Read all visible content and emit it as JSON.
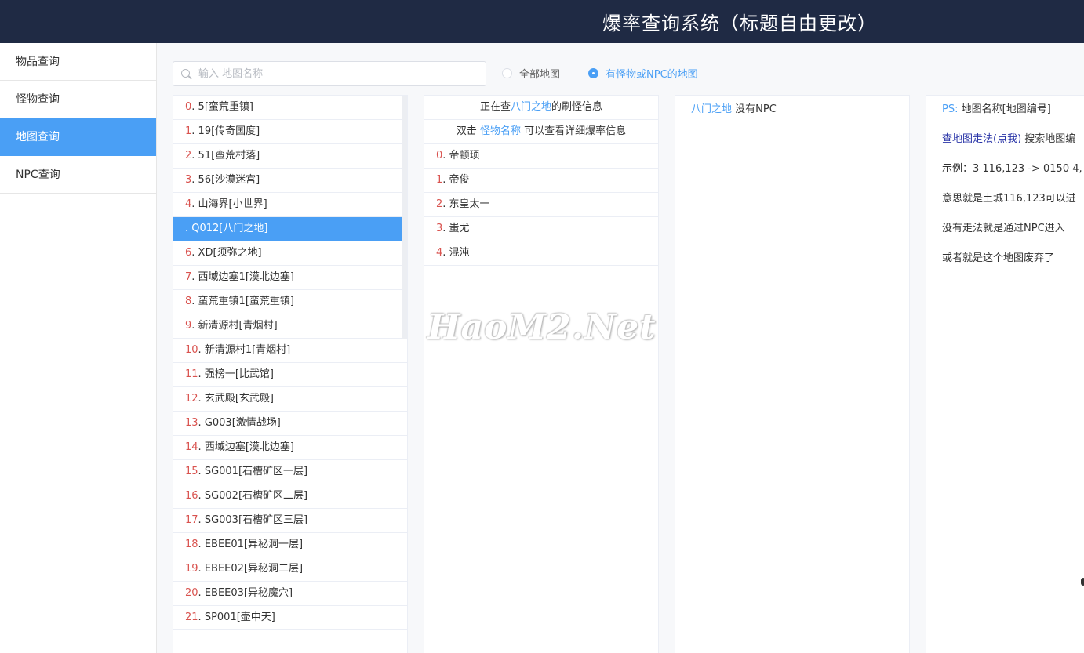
{
  "header": {
    "title": "爆率查询系统（标题自由更改）"
  },
  "sidebar": {
    "items": [
      {
        "label": "物品查询"
      },
      {
        "label": "怪物查询"
      },
      {
        "label": "地图查询"
      },
      {
        "label": "NPC查询"
      }
    ],
    "active_index": 2
  },
  "search": {
    "placeholder": "输入 地图名称"
  },
  "filters": {
    "all_maps": "全部地图",
    "with_monster_npc": "有怪物或NPC的地图",
    "selected": "with_monster_npc"
  },
  "map_list": [
    {
      "idx": "0",
      "text": "5[蛮荒重镇]"
    },
    {
      "idx": "1",
      "text": "19[传奇国度]"
    },
    {
      "idx": "2",
      "text": "51[蛮荒村落]"
    },
    {
      "idx": "3",
      "text": "56[沙漠迷宫]"
    },
    {
      "idx": "4",
      "text": "山海界[小世界]"
    },
    {
      "idx": "",
      "text": "Q012[八门之地]"
    },
    {
      "idx": "6",
      "text": "XD[须弥之地]"
    },
    {
      "idx": "7",
      "text": "西域边塞1[漠北边塞]"
    },
    {
      "idx": "8",
      "text": "蛮荒重镇1[蛮荒重镇]"
    },
    {
      "idx": "9",
      "text": "新清源村[青烟村]"
    },
    {
      "idx": "10",
      "text": "新清源村1[青烟村]"
    },
    {
      "idx": "11",
      "text": "强榜一[比武馆]"
    },
    {
      "idx": "12",
      "text": "玄武殿[玄武殿]"
    },
    {
      "idx": "13",
      "text": "G003[激情战场]"
    },
    {
      "idx": "14",
      "text": "西域边塞[漠北边塞]"
    },
    {
      "idx": "15",
      "text": "SG001[石槽矿区一层]"
    },
    {
      "idx": "16",
      "text": "SG002[石槽矿区二层]"
    },
    {
      "idx": "17",
      "text": "SG003[石槽矿区三层]"
    },
    {
      "idx": "18",
      "text": "EBEE01[异秘洞一层]"
    },
    {
      "idx": "19",
      "text": "EBEE02[异秘洞二层]"
    },
    {
      "idx": "20",
      "text": "EBEE03[异秘魔穴]"
    },
    {
      "idx": "21",
      "text": "SP001[壶中天]"
    }
  ],
  "map_list_selected_index": 5,
  "monster_panel": {
    "head1_prefix": "正在查",
    "head1_map": "八门之地",
    "head1_suffix": "的刷怪信息",
    "head2_prefix": "双击",
    "head2_link": "怪物名称",
    "head2_suffix": "可以查看详细爆率信息",
    "monsters": [
      {
        "idx": "0",
        "name": "帝颛顼"
      },
      {
        "idx": "1",
        "name": "帝俊"
      },
      {
        "idx": "2",
        "name": "东皇太一"
      },
      {
        "idx": "3",
        "name": "蚩尤"
      },
      {
        "idx": "4",
        "name": "混沌"
      }
    ]
  },
  "npc_panel": {
    "map": "八门之地",
    "text": "没有NPC"
  },
  "tips": {
    "ps_label": "PS:",
    "ps_text": "地图名称[地图编号]",
    "guide_link": "查地图走法(点我)",
    "guide_text": "搜索地图编",
    "example": "示例：3 116,123 -> 0150 4,",
    "meaning": "意思就是土城116,123可以进",
    "npc_entry": "没有走法就是通过NPC进入",
    "abandoned": "或者就是这个地图废弃了"
  },
  "watermark": "HaoM2.Net",
  "colors": {
    "header_bg": "#1f2a44",
    "accent": "#4a9ff5",
    "index": "#d9534f"
  }
}
